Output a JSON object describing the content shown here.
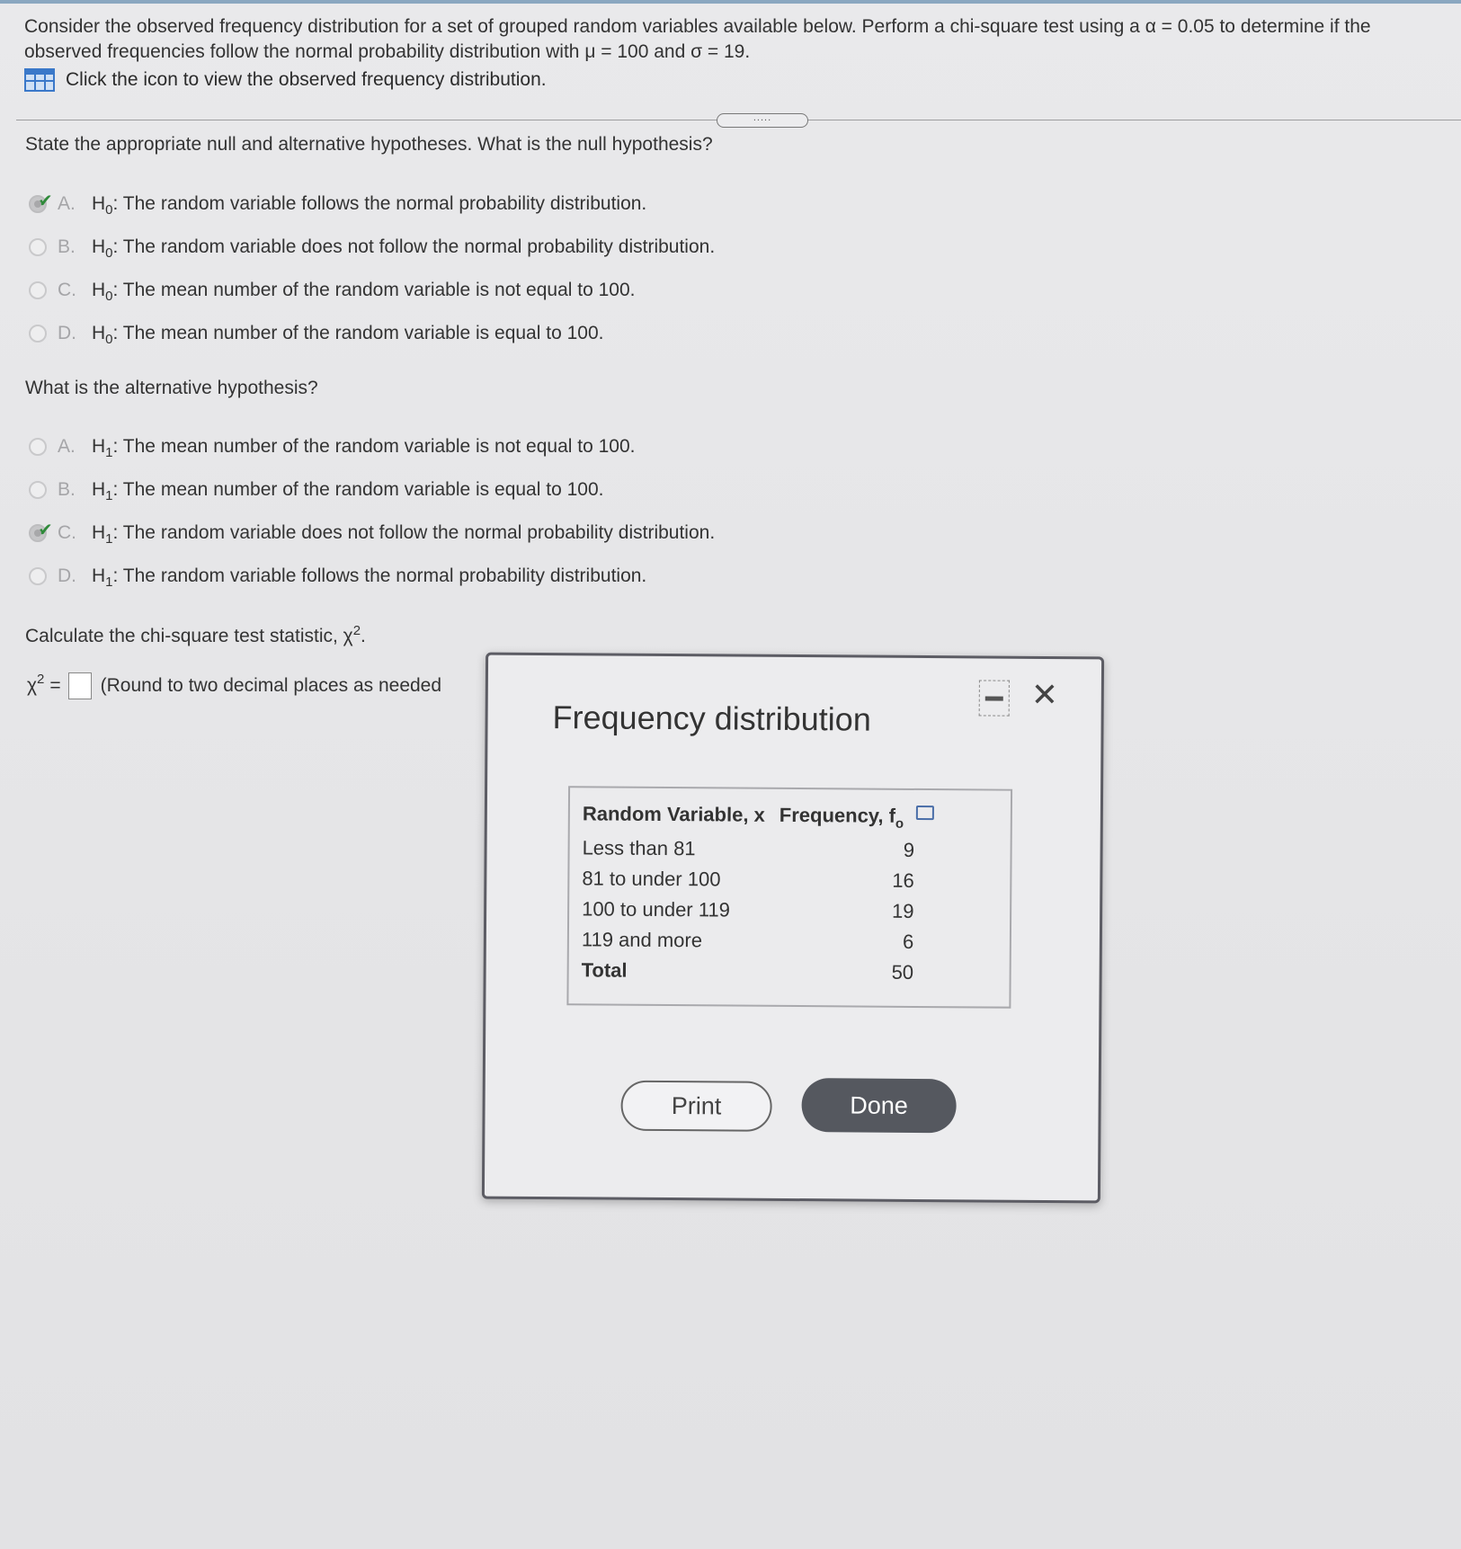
{
  "intro": {
    "text": "Consider the observed frequency distribution for a set of grouped random variables available below. Perform a chi-square test using a α = 0.05 to determine if the observed frequencies follow the normal probability distribution with μ = 100 and σ = 19.",
    "icon_link": "Click the icon to view the observed frequency distribution."
  },
  "expander_label": ".....",
  "null_question": "State the appropriate null and alternative hypotheses. What is the null hypothesis?",
  "null_options": [
    {
      "letter": "A.",
      "h": "H",
      "sub": "0",
      "text": ": The random variable follows the normal probability distribution.",
      "selected": true
    },
    {
      "letter": "B.",
      "h": "H",
      "sub": "0",
      "text": ": The random variable does not follow the normal probability distribution.",
      "selected": false
    },
    {
      "letter": "C.",
      "h": "H",
      "sub": "0",
      "text": ": The mean number of the random variable is not equal to 100.",
      "selected": false
    },
    {
      "letter": "D.",
      "h": "H",
      "sub": "0",
      "text": ": The mean number of the random variable is equal to 100.",
      "selected": false
    }
  ],
  "alt_question": "What is the alternative hypothesis?",
  "alt_options": [
    {
      "letter": "A.",
      "h": "H",
      "sub": "1",
      "text": ": The mean number of the random variable is not equal to 100.",
      "selected": false
    },
    {
      "letter": "B.",
      "h": "H",
      "sub": "1",
      "text": ": The mean number of the random variable is equal to 100.",
      "selected": false
    },
    {
      "letter": "C.",
      "h": "H",
      "sub": "1",
      "text": ": The random variable does not follow the normal probability distribution.",
      "selected": true
    },
    {
      "letter": "D.",
      "h": "H",
      "sub": "1",
      "text": ": The random variable follows the normal probability distribution.",
      "selected": false
    }
  ],
  "chi_question": "Calculate the chi-square test statistic, χ",
  "chi_question_sup": "2",
  "chi_question_end": ".",
  "answer": {
    "prefix": "χ",
    "prefix_sup": "2",
    "equals": "=",
    "value": "",
    "note": "(Round to two decimal places as needed"
  },
  "dialog": {
    "title": "Frequency distribution",
    "close_glyph": "✕",
    "headers": {
      "x": "Random Variable, x",
      "f": "Frequency, f",
      "f_sub": "o"
    },
    "rows": [
      {
        "x": "Less than 81",
        "f": "9"
      },
      {
        "x": "81 to under 100",
        "f": "16"
      },
      {
        "x": "100 to under 119",
        "f": "19"
      },
      {
        "x": "119 and more",
        "f": "6"
      }
    ],
    "total": {
      "x": "Total",
      "f": "50"
    },
    "print_label": "Print",
    "done_label": "Done"
  }
}
